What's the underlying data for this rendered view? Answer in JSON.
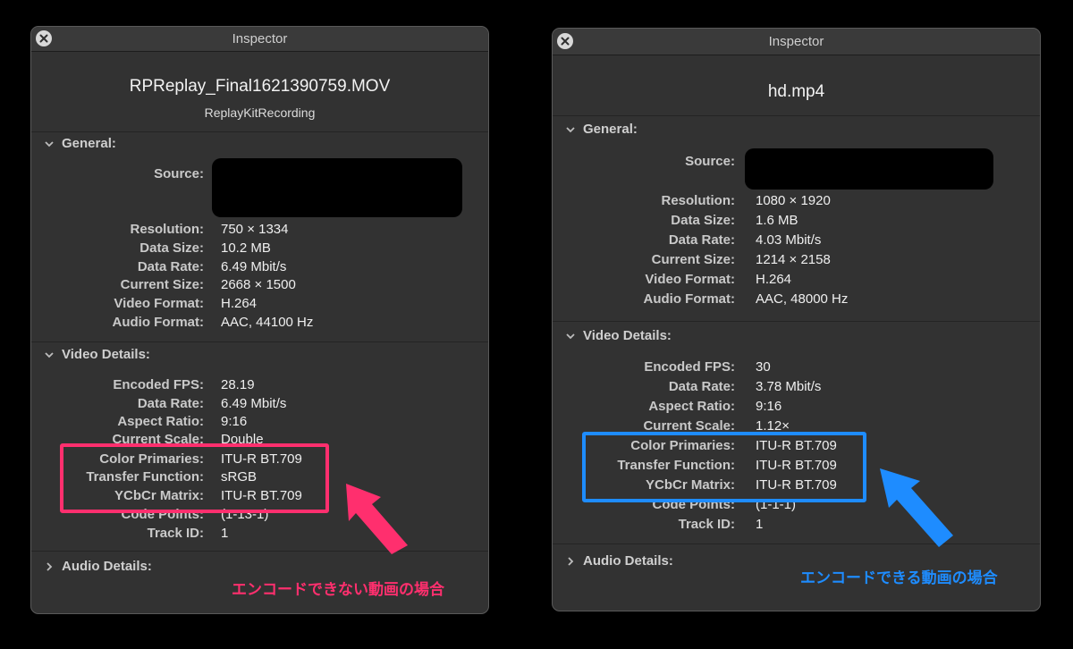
{
  "left": {
    "title": "Inspector",
    "filename": "RPReplay_Final1621390759.MOV",
    "subtitle": "ReplayKitRecording",
    "general": {
      "title": "General:",
      "rows": [
        {
          "label": "Source:",
          "value": ""
        },
        {
          "label": "Resolution:",
          "value": "750 × 1334"
        },
        {
          "label": "Data Size:",
          "value": "10.2 MB"
        },
        {
          "label": "Data Rate:",
          "value": "6.49 Mbit/s"
        },
        {
          "label": "Current Size:",
          "value": "2668 × 1500"
        },
        {
          "label": "Video Format:",
          "value": "H.264"
        },
        {
          "label": "Audio Format:",
          "value": "AAC, 44100 Hz"
        }
      ]
    },
    "video": {
      "title": "Video Details:",
      "rows": [
        {
          "label": "Encoded FPS:",
          "value": "28.19"
        },
        {
          "label": "Data Rate:",
          "value": "6.49 Mbit/s"
        },
        {
          "label": "Aspect Ratio:",
          "value": "9:16"
        },
        {
          "label": "Current Scale:",
          "value": "Double"
        },
        {
          "label": "Color Primaries:",
          "value": "ITU-R BT.709"
        },
        {
          "label": "Transfer Function:",
          "value": "sRGB"
        },
        {
          "label": "YCbCr Matrix:",
          "value": "ITU-R BT.709"
        },
        {
          "label": "Code Points:",
          "value": "(1-13-1)"
        },
        {
          "label": "Track ID:",
          "value": "1"
        }
      ]
    },
    "audio": {
      "title": "Audio Details:"
    },
    "annotation": "エンコードできない動画の場合"
  },
  "right": {
    "title": "Inspector",
    "filename": "hd.mp4",
    "general": {
      "title": "General:",
      "rows": [
        {
          "label": "Source:",
          "value": ""
        },
        {
          "label": "Resolution:",
          "value": "1080 × 1920"
        },
        {
          "label": "Data Size:",
          "value": "1.6 MB"
        },
        {
          "label": "Data Rate:",
          "value": "4.03 Mbit/s"
        },
        {
          "label": "Current Size:",
          "value": "1214 × 2158"
        },
        {
          "label": "Video Format:",
          "value": "H.264"
        },
        {
          "label": "Audio Format:",
          "value": "AAC, 48000 Hz"
        }
      ]
    },
    "video": {
      "title": "Video Details:",
      "rows": [
        {
          "label": "Encoded FPS:",
          "value": "30"
        },
        {
          "label": "Data Rate:",
          "value": "3.78 Mbit/s"
        },
        {
          "label": "Aspect Ratio:",
          "value": "9:16"
        },
        {
          "label": "Current Scale:",
          "value": "1.12×"
        },
        {
          "label": "Color Primaries:",
          "value": "ITU-R BT.709"
        },
        {
          "label": "Transfer Function:",
          "value": "ITU-R BT.709"
        },
        {
          "label": "YCbCr Matrix:",
          "value": "ITU-R BT.709"
        },
        {
          "label": "Code Points:",
          "value": "(1-1-1)"
        },
        {
          "label": "Track ID:",
          "value": "1"
        }
      ]
    },
    "audio": {
      "title": "Audio Details:"
    },
    "annotation": "エンコードできる動画の場合"
  },
  "colors": {
    "highlight_left": "#ff2f6e",
    "highlight_right": "#1e8cff"
  },
  "icons": {
    "close": "close-icon",
    "expanded": "chevron-down-icon",
    "collapsed": "chevron-right-icon",
    "arrow": "arrow-icon"
  }
}
